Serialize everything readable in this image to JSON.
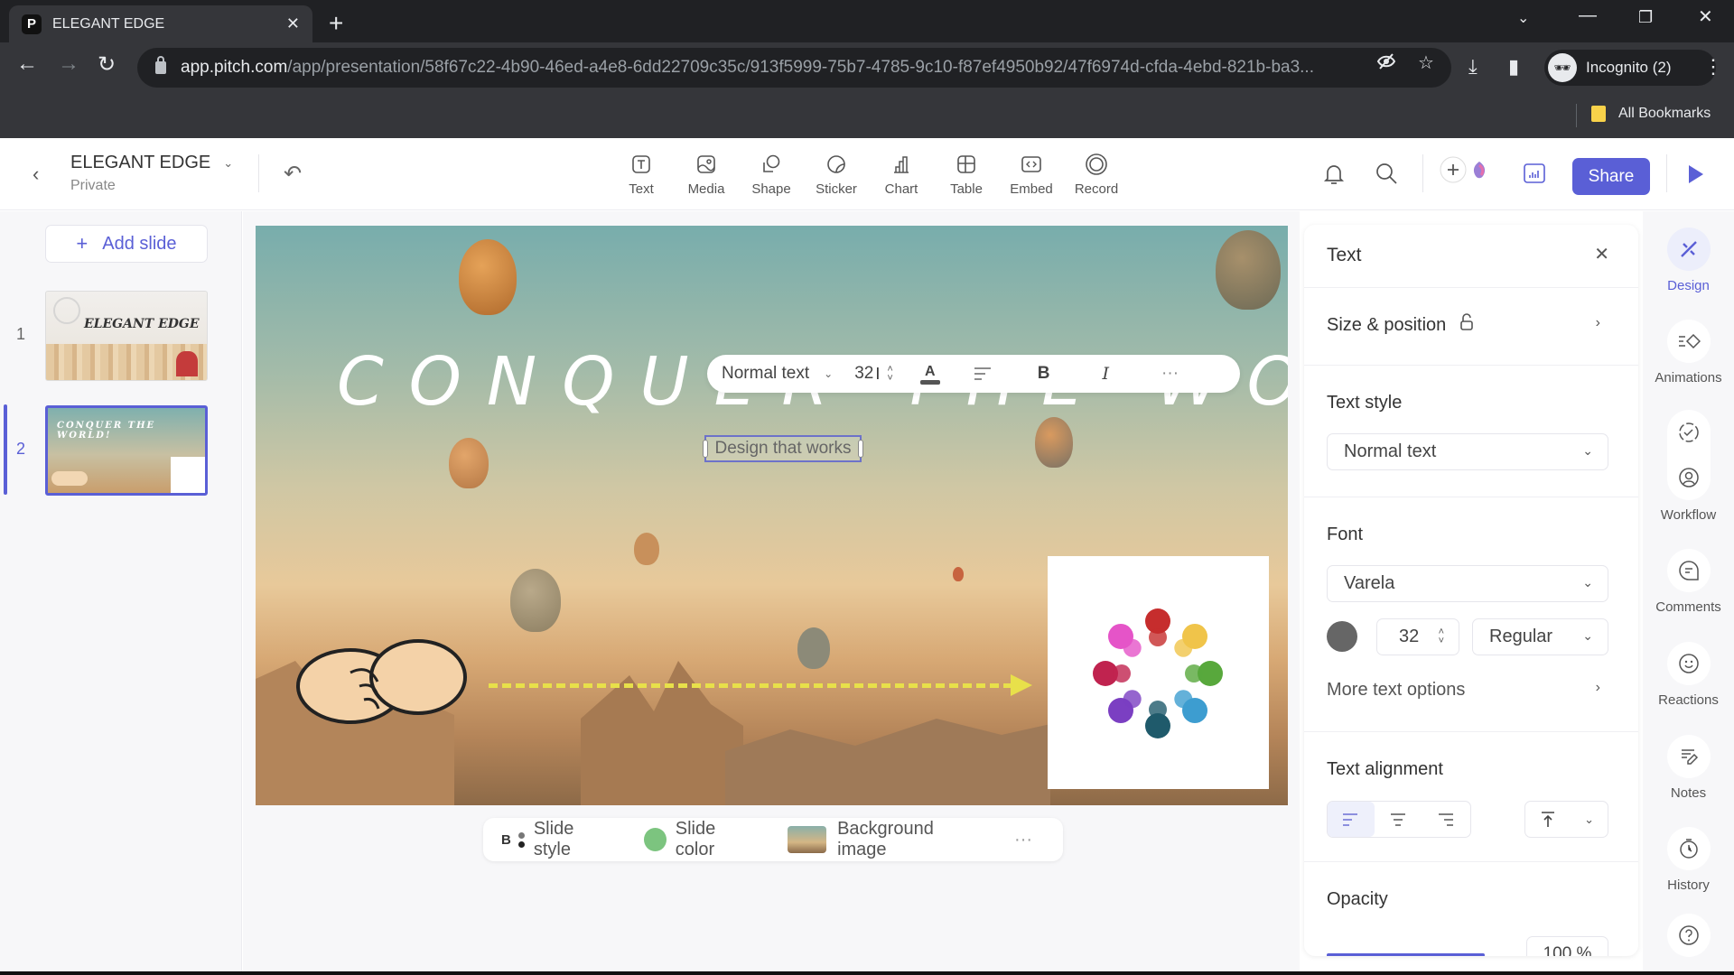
{
  "browser": {
    "tab_title": "ELEGANT EDGE",
    "tab_favicon": "pitch-logo-icon",
    "url_host": "app.pitch.com",
    "url_path": "/app/presentation/58f67c22-4b90-46ed-a4e8-6dd22709c35c/913f5999-75b7-4785-9c10-f87ef4950b92/47f6974d-cfda-4ebd-821b-ba3...",
    "profile_label": "Incognito (2)",
    "bookmarks_label": "All Bookmarks"
  },
  "header": {
    "deck_title": "ELEGANT EDGE",
    "deck_visibility": "Private",
    "insert_tools": [
      {
        "label": "Text",
        "icon": "text-icon"
      },
      {
        "label": "Media",
        "icon": "image-icon"
      },
      {
        "label": "Shape",
        "icon": "shape-icon"
      },
      {
        "label": "Sticker",
        "icon": "sticker-icon"
      },
      {
        "label": "Chart",
        "icon": "chart-icon"
      },
      {
        "label": "Table",
        "icon": "table-icon"
      },
      {
        "label": "Embed",
        "icon": "embed-icon"
      },
      {
        "label": "Record",
        "icon": "record-icon"
      }
    ],
    "share_label": "Share"
  },
  "slides_rail": {
    "add_slide_label": "Add slide",
    "slides": [
      {
        "number": "1",
        "thumb_title": "ELEGANT EDGE"
      },
      {
        "number": "2",
        "thumb_title": "CONQUER THE WORLD!"
      }
    ],
    "active_slide": 2
  },
  "slide": {
    "title": "CONQUER THE WORLD!",
    "subtitle": "Design that works"
  },
  "floating_toolbar": {
    "text_style": "Normal text",
    "font_size": "32"
  },
  "slide_bar": {
    "slide_style_label": "Slide style",
    "slide_style_badge": "B",
    "slide_color_label": "Slide color",
    "slide_color": "#7cc47f",
    "background_image_label": "Background image"
  },
  "props_panel": {
    "title": "Text",
    "size_position_label": "Size & position",
    "text_style_heading": "Text style",
    "text_style_value": "Normal text",
    "font_heading": "Font",
    "font_value": "Varela",
    "font_color": "#666666",
    "font_size": "32",
    "font_weight": "Regular",
    "more_text_options_label": "More text options",
    "text_alignment_heading": "Text alignment",
    "active_alignment": "left",
    "opacity_heading": "Opacity",
    "opacity_value": "100 %",
    "opacity_fraction": 1.0
  },
  "right_rail": {
    "items": [
      {
        "label": "Design",
        "icon": "design-icon",
        "active": true
      },
      {
        "label": "Animations",
        "icon": "animations-icon"
      },
      {
        "label": "Workflow",
        "icon": "workflow-icon"
      },
      {
        "label": "Comments",
        "icon": "comments-icon"
      },
      {
        "label": "Reactions",
        "icon": "reactions-icon"
      },
      {
        "label": "Notes",
        "icon": "notes-icon"
      },
      {
        "label": "History",
        "icon": "history-icon"
      }
    ]
  },
  "colors": {
    "accent": "#5a5fd6",
    "browser_dark": "#202124",
    "browser_toolbar": "#35363a"
  }
}
